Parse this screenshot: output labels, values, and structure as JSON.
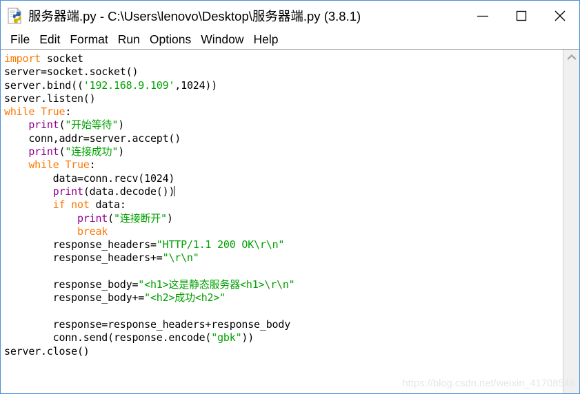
{
  "window": {
    "title": "服务器端.py - C:\\Users\\lenovo\\Desktop\\服务器端.py (3.8.1)",
    "app_icon_name": "python-idle-file-icon",
    "controls": {
      "minimize": "–",
      "maximize": "□",
      "close": "✕"
    }
  },
  "menubar": {
    "items": [
      {
        "label": "File"
      },
      {
        "label": "Edit"
      },
      {
        "label": "Format"
      },
      {
        "label": "Run"
      },
      {
        "label": "Options"
      },
      {
        "label": "Window"
      },
      {
        "label": "Help"
      }
    ]
  },
  "colors": {
    "keyword": "#ff7700",
    "string": "#00a000",
    "builtin": "#900090",
    "text": "#000000",
    "window_border": "#4a90d9",
    "scrollbar_track": "#f0f0f0",
    "watermark": "#e2e6e9"
  },
  "editor": {
    "caret_line_index": 10,
    "lines": [
      {
        "n": 1,
        "tokens": [
          {
            "t": "kw",
            "s": "import"
          },
          {
            "t": "plain",
            "s": " socket"
          }
        ]
      },
      {
        "n": 2,
        "tokens": [
          {
            "t": "plain",
            "s": "server=socket.socket()"
          }
        ]
      },
      {
        "n": 3,
        "tokens": [
          {
            "t": "plain",
            "s": "server.bind(("
          },
          {
            "t": "str",
            "s": "'192.168.9.109'"
          },
          {
            "t": "plain",
            "s": ",1024))"
          }
        ]
      },
      {
        "n": 4,
        "tokens": [
          {
            "t": "plain",
            "s": "server.listen()"
          }
        ]
      },
      {
        "n": 5,
        "tokens": [
          {
            "t": "kw",
            "s": "while"
          },
          {
            "t": "plain",
            "s": " "
          },
          {
            "t": "kw",
            "s": "True"
          },
          {
            "t": "plain",
            "s": ":"
          }
        ]
      },
      {
        "n": 6,
        "tokens": [
          {
            "t": "plain",
            "s": "    "
          },
          {
            "t": "bi",
            "s": "print"
          },
          {
            "t": "plain",
            "s": "("
          },
          {
            "t": "str",
            "s": "\"开始等待\""
          },
          {
            "t": "plain",
            "s": ")"
          }
        ]
      },
      {
        "n": 7,
        "tokens": [
          {
            "t": "plain",
            "s": "    conn,addr=server.accept()"
          }
        ]
      },
      {
        "n": 8,
        "tokens": [
          {
            "t": "plain",
            "s": "    "
          },
          {
            "t": "bi",
            "s": "print"
          },
          {
            "t": "plain",
            "s": "("
          },
          {
            "t": "str",
            "s": "\"连接成功\""
          },
          {
            "t": "plain",
            "s": ")"
          }
        ]
      },
      {
        "n": 9,
        "tokens": [
          {
            "t": "plain",
            "s": "    "
          },
          {
            "t": "kw",
            "s": "while"
          },
          {
            "t": "plain",
            "s": " "
          },
          {
            "t": "kw",
            "s": "True"
          },
          {
            "t": "plain",
            "s": ":"
          }
        ]
      },
      {
        "n": 10,
        "tokens": [
          {
            "t": "plain",
            "s": "        data=conn.recv(1024)"
          }
        ]
      },
      {
        "n": 11,
        "tokens": [
          {
            "t": "plain",
            "s": "        "
          },
          {
            "t": "bi",
            "s": "print"
          },
          {
            "t": "plain",
            "s": "(data.decode())"
          }
        ]
      },
      {
        "n": 12,
        "tokens": [
          {
            "t": "plain",
            "s": "        "
          },
          {
            "t": "kw",
            "s": "if"
          },
          {
            "t": "plain",
            "s": " "
          },
          {
            "t": "kw",
            "s": "not"
          },
          {
            "t": "plain",
            "s": " data:"
          }
        ]
      },
      {
        "n": 13,
        "tokens": [
          {
            "t": "plain",
            "s": "            "
          },
          {
            "t": "bi",
            "s": "print"
          },
          {
            "t": "plain",
            "s": "("
          },
          {
            "t": "str",
            "s": "\"连接断开\""
          },
          {
            "t": "plain",
            "s": ")"
          }
        ]
      },
      {
        "n": 14,
        "tokens": [
          {
            "t": "plain",
            "s": "            "
          },
          {
            "t": "kw",
            "s": "break"
          }
        ]
      },
      {
        "n": 15,
        "tokens": [
          {
            "t": "plain",
            "s": "        response_headers="
          },
          {
            "t": "str",
            "s": "\"HTTP/1.1 200 OK\\r\\n\""
          }
        ]
      },
      {
        "n": 16,
        "tokens": [
          {
            "t": "plain",
            "s": "        response_headers+="
          },
          {
            "t": "str",
            "s": "\"\\r\\n\""
          }
        ]
      },
      {
        "n": 17,
        "tokens": [
          {
            "t": "plain",
            "s": ""
          }
        ]
      },
      {
        "n": 18,
        "tokens": [
          {
            "t": "plain",
            "s": "        response_body="
          },
          {
            "t": "str",
            "s": "\"<h1>这是静态服务器<h1>\\r\\n\""
          }
        ]
      },
      {
        "n": 19,
        "tokens": [
          {
            "t": "plain",
            "s": "        response_body+="
          },
          {
            "t": "str",
            "s": "\"<h2>成功<h2>\""
          }
        ]
      },
      {
        "n": 20,
        "tokens": [
          {
            "t": "plain",
            "s": ""
          }
        ]
      },
      {
        "n": 21,
        "tokens": [
          {
            "t": "plain",
            "s": "        response=response_headers+response_body"
          }
        ]
      },
      {
        "n": 22,
        "tokens": [
          {
            "t": "plain",
            "s": "        conn.send(response.encode("
          },
          {
            "t": "str",
            "s": "\"gbk\""
          },
          {
            "t": "plain",
            "s": "))"
          }
        ]
      },
      {
        "n": 23,
        "tokens": [
          {
            "t": "plain",
            "s": "server.close()"
          }
        ]
      }
    ]
  },
  "scrollbar": {
    "up_arrow": "chevron-up",
    "down_arrow": "chevron-down"
  },
  "watermark": {
    "text": "https://blog.csdn.net/weixin_41708548"
  }
}
